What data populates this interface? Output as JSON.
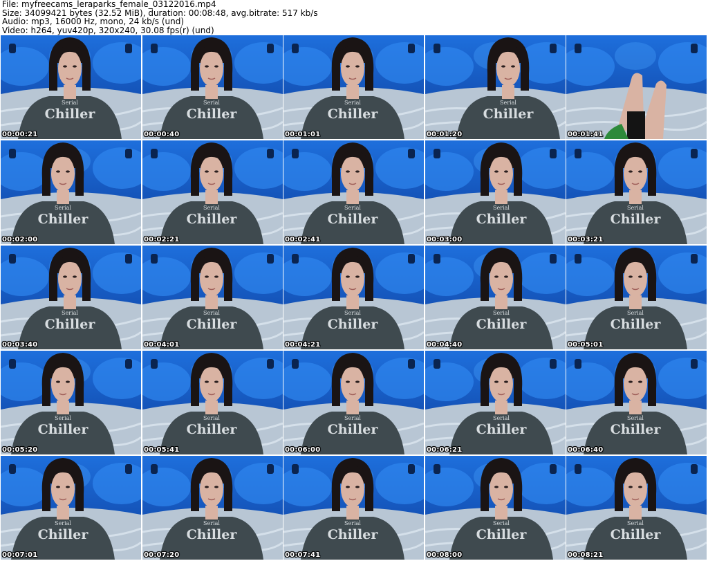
{
  "info": {
    "file": "File: myfreecams_leraparks_female_03122016.mp4",
    "size": "Size: 34099421 bytes (32.52 MiB), duration: 00:08:48, avg.bitrate: 517 kb/s",
    "audio": "Audio: mp3, 16000 Hz, mono, 24 kb/s (und)",
    "video": "Video: h264, yuv420p, 320x240, 30.08 fps(r) (und)"
  },
  "colors": {
    "wall": "#1e6fdc",
    "wall_dark": "#0d3f9e",
    "bed": "#b8c6d4",
    "sweater": "#3f4a4f",
    "hair": "#1a1414",
    "skin": "#d9b3a3"
  },
  "thumbnails": [
    {
      "time": "00:00:21"
    },
    {
      "time": "00:00:40"
    },
    {
      "time": "00:01:01"
    },
    {
      "time": "00:01:20"
    },
    {
      "time": "00:01:41"
    },
    {
      "time": "00:02:00"
    },
    {
      "time": "00:02:21"
    },
    {
      "time": "00:02:41"
    },
    {
      "time": "00:03:00"
    },
    {
      "time": "00:03:21"
    },
    {
      "time": "00:03:40"
    },
    {
      "time": "00:04:01"
    },
    {
      "time": "00:04:21"
    },
    {
      "time": "00:04:40"
    },
    {
      "time": "00:05:01"
    },
    {
      "time": "00:05:20"
    },
    {
      "time": "00:05:41"
    },
    {
      "time": "00:06:00"
    },
    {
      "time": "00:06:21"
    },
    {
      "time": "00:06:40"
    },
    {
      "time": "00:07:01"
    },
    {
      "time": "00:07:20"
    },
    {
      "time": "00:07:41"
    },
    {
      "time": "00:08:00"
    },
    {
      "time": "00:08:21"
    }
  ]
}
